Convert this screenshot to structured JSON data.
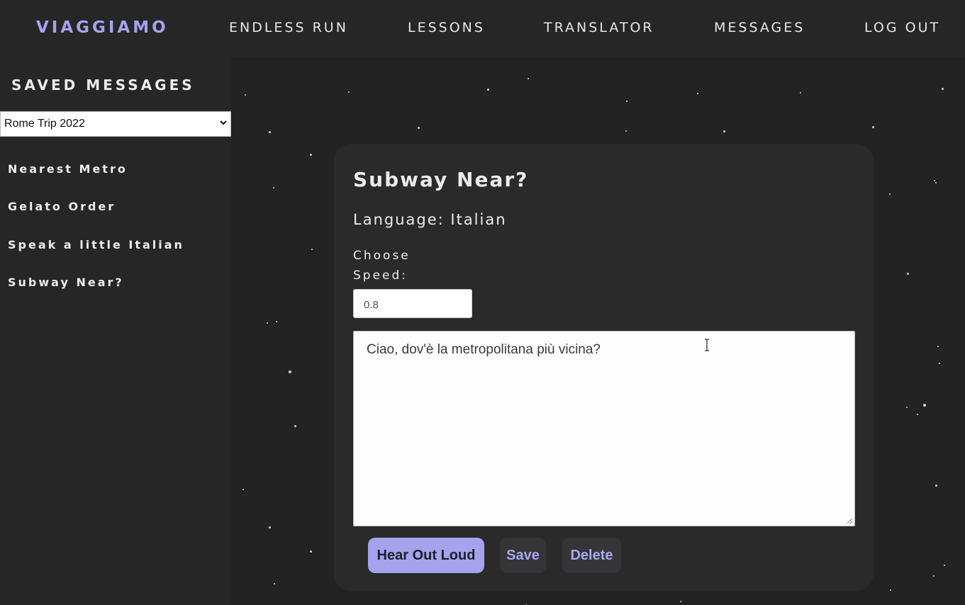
{
  "nav": {
    "brand": "VIAGGIAMO",
    "links": [
      "ENDLESS RUN",
      "LESSONS",
      "TRANSLATOR",
      "MESSAGES",
      "LOG OUT"
    ]
  },
  "sidebar": {
    "title": "SAVED MESSAGES",
    "trip_select": {
      "selected": "Rome Trip 2022"
    },
    "items": [
      {
        "label": "Nearest Metro"
      },
      {
        "label": "Gelato Order"
      },
      {
        "label": "Speak a little Italian"
      },
      {
        "label": "Subway Near?"
      }
    ]
  },
  "card": {
    "title": "Subway Near?",
    "language": "Language: Italian",
    "speed_label": "Choose Speed:",
    "speed_value": "0.8",
    "message_text": "Ciao, dov'è la metropolitana più vicina?",
    "buttons": {
      "hear": "Hear Out Loud",
      "save": "Save",
      "delete": "Delete"
    }
  },
  "colors": {
    "accent": "#a5a3ee",
    "background": "#232324",
    "panel": "#2a2a2b"
  }
}
